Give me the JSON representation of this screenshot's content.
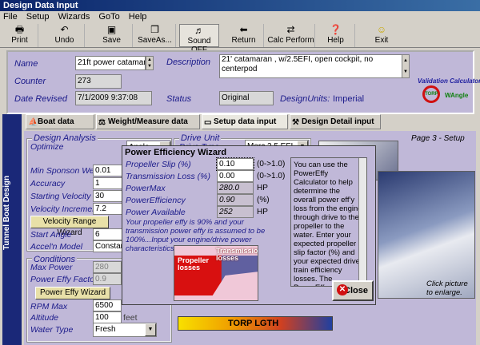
{
  "window": {
    "title": "Design Data Input"
  },
  "menu": [
    "File",
    "Setup",
    "Wizards",
    "GoTo",
    "Help"
  ],
  "toolbar": {
    "print": "Print",
    "undo": "Undo",
    "save": "Save",
    "save_as": "SaveAs...",
    "sound": "Sound OFF",
    "return": "Return",
    "calc": "Calc Perform",
    "help": "Help",
    "exit": "Exit"
  },
  "header": {
    "name_label": "Name",
    "name_value": "21ft power catamaran",
    "counter_label": "Counter",
    "counter_value": "273",
    "date_label": "Date Revised",
    "date_value": "7/1/2009 9:37:08",
    "description_label": "Description",
    "description_value": "21' catamaran , w/2.5EFI, open cockpit, no centerpod",
    "status_label": "Status",
    "status_value": "Original",
    "units_label": "DesignUnits:",
    "units_value": "Imperial",
    "logo_line1": "Validation Calculator",
    "logo_line2": "TORP",
    "logo_line3": "WAngle"
  },
  "sidebar": {
    "label": "Tunnel Boat Design"
  },
  "tabs": [
    "Boat data input",
    "Weight/Measure data input",
    "Setup data input",
    "Design Detail input"
  ],
  "page_label": "Page 3 - Setup",
  "design_analysis": {
    "title": "Design Analysis",
    "optimize_label": "Optimize",
    "optimize_value": "Angle",
    "min_sponson_label": "Min Sponson Wet",
    "min_sponson_value": "0.01",
    "accuracy_label": "Accuracy",
    "accuracy_value": "1",
    "start_vel_label": "Starting Velocity",
    "start_vel_value": "30",
    "vel_inc_label": "Velocity Increment",
    "vel_inc_value": "7.2",
    "vel_wizard": "Velocity Range Wizard",
    "start_angle_label": "Start Angle",
    "start_angle_value": "6",
    "accel_label": "Accel'n Model",
    "accel_value": "Constant"
  },
  "drive_unit": {
    "title": "Drive Unit",
    "type_label": "Drive Type",
    "type_value": "Merc 2.5 EFI"
  },
  "conditions": {
    "title": "Conditions",
    "max_power_label": "Max Power",
    "max_power_value": "280",
    "pef_label": "Power Effy Factor",
    "pef_value": "0.9",
    "wizard": "Power Effy Wizard",
    "rpm_label": "RPM Max",
    "rpm_value": "6500",
    "alt_label": "Altitude",
    "alt_value": "100",
    "alt_unit": "feet",
    "water_label": "Water Type",
    "water_value": "Fresh"
  },
  "click_picture": "Click picture to enlarge.",
  "torp_banner": "TORP LGTH",
  "dialog": {
    "title": "Power Efficiency Wizard",
    "rows": [
      {
        "label": "Propeller Slip (%)",
        "value": "0.10",
        "range": "(0->1.0)"
      },
      {
        "label": "Transmission Loss (%)",
        "value": "0.00",
        "range": "(0->1.0)"
      },
      {
        "label": "PowerMax",
        "value": "280.0",
        "range": "HP"
      },
      {
        "label": "PowerEfficiency",
        "value": "0.90",
        "range": "(%)"
      },
      {
        "label": "Power Available",
        "value": "252",
        "range": "HP"
      }
    ],
    "note": "Your propeller effy is 90% and your transmission power effy is assumed to be 100%...Input your engine/drive power characteristics...",
    "diagram_label1": "Propeller losses",
    "diagram_label2": "Transmission losses",
    "help": "You can use the PowerEffy Calculator to help determine the overall power eff'y loss from the engine through drive to the propeller to the water. Enter your expected propeller slip factor (%) and your expected drive train efficiency losses. The PowerEffy Calculator will compute your overall PowerEfficiency.",
    "close": "Close"
  }
}
